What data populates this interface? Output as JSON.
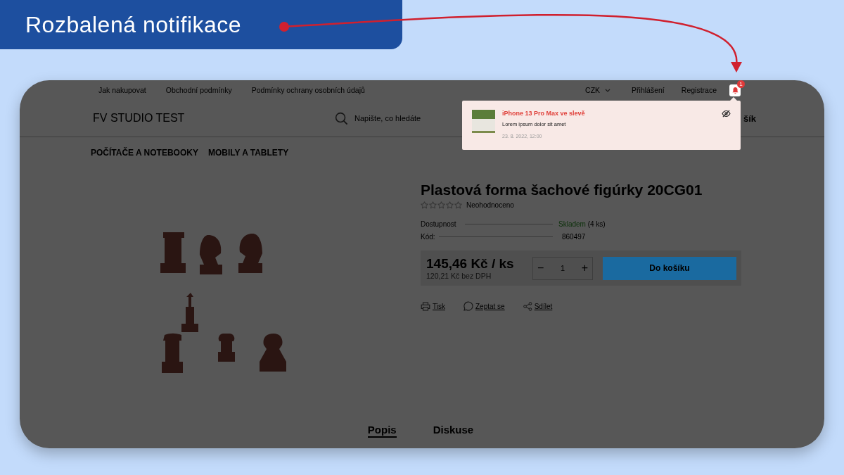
{
  "annotation": {
    "label": "Rozbalená notifikace"
  },
  "top_bar": {
    "links": [
      "Jak nakupovat",
      "Obchodní podmínky",
      "Podmínky ochrany osobních údajů"
    ],
    "currency": "CZK",
    "login": "Přihlášení",
    "register": "Registrace",
    "notification_count": "1"
  },
  "header": {
    "logo": "FV STUDIO TEST",
    "search": {
      "placeholder": "Napište, co hledáte"
    },
    "cart": "šík"
  },
  "categories": [
    "POČÍTAČE A NOTEBOOKY",
    "MOBILY A TABLETY"
  ],
  "notification": {
    "title": "iPhone 13 Pro Max ve slevě",
    "body": "Lorem ipsum dolor sit amet",
    "date": "23. 8. 2022, 12:00"
  },
  "product": {
    "title": "Plastová forma šachové figúrky 20CG01",
    "stars": 0,
    "rating_label": "Neohodnoceno",
    "params": [
      {
        "kind": "stock",
        "label": "Dostupnost",
        "value": "Skladem",
        "extra": "(4 ks)"
      },
      {
        "kind": "plain",
        "label": "Kód:",
        "value": "860497"
      }
    ],
    "price": "145,46 Kč / ks",
    "price_net": "120,21 Kč bez DPH",
    "minus": "−",
    "quantity": "1",
    "plus": "+",
    "add_to_cart": "Do košíku",
    "actions": [
      {
        "kind": "print",
        "label": "Tisk"
      },
      {
        "kind": "chat",
        "label": "Zeptat se"
      },
      {
        "kind": "share",
        "label": "Sdílet"
      }
    ]
  },
  "tabs": [
    {
      "label": "Popis",
      "selected": true
    },
    {
      "label": "Diskuse",
      "selected": false
    }
  ]
}
